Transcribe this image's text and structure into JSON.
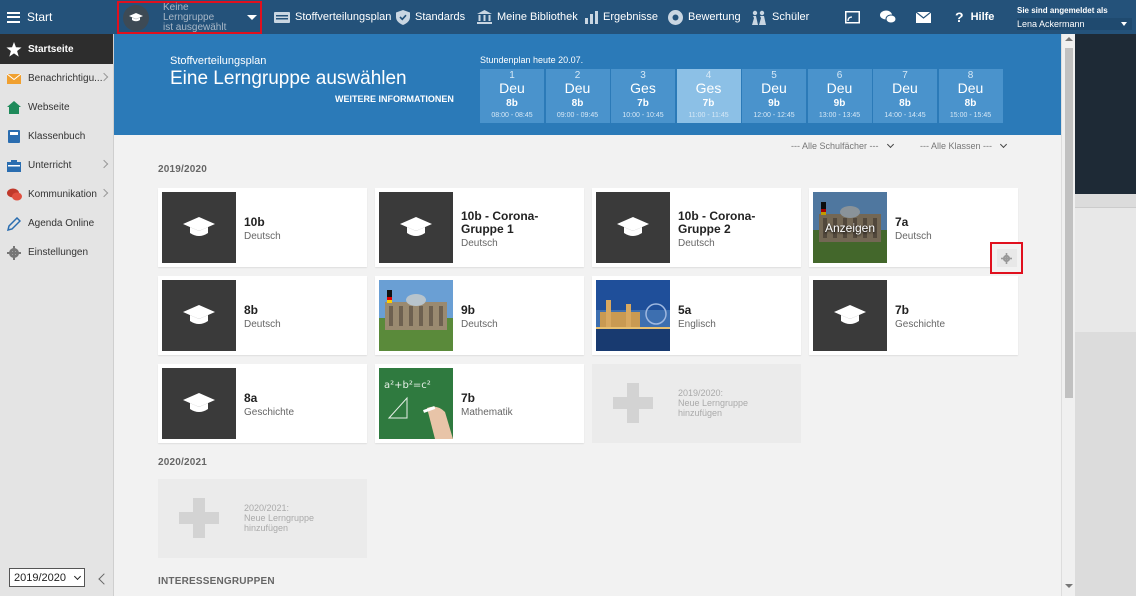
{
  "topbar": {
    "start_label": "Start",
    "group_line1": "Keine Lerngruppe",
    "group_line2": "ist ausgewählt",
    "nav": [
      {
        "label": "Stoffverteilungsplan",
        "icon": "stoffverteilungsplan-icon"
      },
      {
        "label": "Standards",
        "icon": "shield-icon"
      },
      {
        "label": "Meine Bibliothek",
        "icon": "library-icon"
      },
      {
        "label": "Ergebnisse",
        "icon": "bar-chart-icon"
      },
      {
        "label": "Bewertung",
        "icon": "tag-icon"
      },
      {
        "label": "Schüler",
        "icon": "students-icon"
      }
    ],
    "help_label": "Hilfe",
    "login_title": "Sie sind angemeldet als",
    "login_user": "Lena Ackermann"
  },
  "sidebar": {
    "items": [
      {
        "label": "Startseite",
        "icon": "star-icon",
        "active": true
      },
      {
        "label": "Benachrichtigu...",
        "icon": "envelope-icon"
      },
      {
        "label": "Webseite",
        "icon": "home-icon"
      },
      {
        "label": "Klassenbuch",
        "icon": "book-icon"
      },
      {
        "label": "Unterricht",
        "icon": "folder-icon"
      },
      {
        "label": "Kommunikation",
        "icon": "chat-icon"
      },
      {
        "label": "Agenda Online",
        "icon": "pen-icon"
      },
      {
        "label": "Einstellungen",
        "icon": "gear-icon"
      }
    ],
    "year_select": "2019/2020"
  },
  "hero": {
    "subtitle": "Stoffverteilungsplan",
    "title": "Eine Lerngruppe auswählen",
    "more_info": "WEITERE INFORMATIONEN",
    "plan_label": "Stundenplan heute 20.07."
  },
  "periods": [
    {
      "num": "1",
      "subject": "Deu",
      "class": "8b",
      "time": "08:00 - 08:45"
    },
    {
      "num": "2",
      "subject": "Deu",
      "class": "8b",
      "time": "09:00 - 09:45"
    },
    {
      "num": "3",
      "subject": "Ges",
      "class": "7b",
      "time": "10:00 - 10:45"
    },
    {
      "num": "4",
      "subject": "Ges",
      "class": "7b",
      "time": "11:00 - 11:45",
      "current": true
    },
    {
      "num": "5",
      "subject": "Deu",
      "class": "9b",
      "time": "12:00 - 12:45"
    },
    {
      "num": "6",
      "subject": "Deu",
      "class": "9b",
      "time": "13:00 - 13:45"
    },
    {
      "num": "7",
      "subject": "Deu",
      "class": "8b",
      "time": "14:00 - 14:45"
    },
    {
      "num": "8",
      "subject": "Deu",
      "class": "8b",
      "time": "15:00 - 15:45"
    }
  ],
  "filters": {
    "subjects": "--- Alle Schulfächer ---",
    "classes": "--- Alle Klassen ---"
  },
  "sections": [
    {
      "title": "2019/2020",
      "groups": [
        {
          "name": "10b",
          "subject": "Deutsch",
          "thumb": "graduation-cap-icon"
        },
        {
          "name": "10b - Corona-Gruppe 1",
          "subject": "Deutsch",
          "thumb": "graduation-cap-icon"
        },
        {
          "name": "10b - Corona-Gruppe 2",
          "subject": "Deutsch",
          "thumb": "graduation-cap-icon"
        },
        {
          "name": "7a",
          "subject": "Deutsch",
          "thumb": "reichstag-photo",
          "overlay": "Anzeigen"
        },
        {
          "name": "8b",
          "subject": "Deutsch",
          "thumb": "graduation-cap-icon"
        },
        {
          "name": "9b",
          "subject": "Deutsch",
          "thumb": "reichstag-photo"
        },
        {
          "name": "5a",
          "subject": "Englisch",
          "thumb": "london-photo"
        },
        {
          "name": "7b",
          "subject": "Geschichte",
          "thumb": "graduation-cap-icon"
        },
        {
          "name": "8a",
          "subject": "Geschichte",
          "thumb": "graduation-cap-icon"
        },
        {
          "name": "7b",
          "subject": "Mathematik",
          "thumb": "chalkboard-photo"
        }
      ],
      "add_label": [
        "2019/2020:",
        "Neue Lerngruppe",
        "hinzufügen"
      ]
    },
    {
      "title": "2020/2021",
      "add_label": [
        "2020/2021:",
        "Neue Lerngruppe",
        "hinzufügen"
      ]
    },
    {
      "title": "INTERESSENGRUPPEN"
    }
  ],
  "colors": {
    "topbar": "#24527a",
    "hero": "#2b7ab8",
    "period": "#4a93cc",
    "period_current": "#8cc0e6",
    "highlight": "#e0101e"
  }
}
